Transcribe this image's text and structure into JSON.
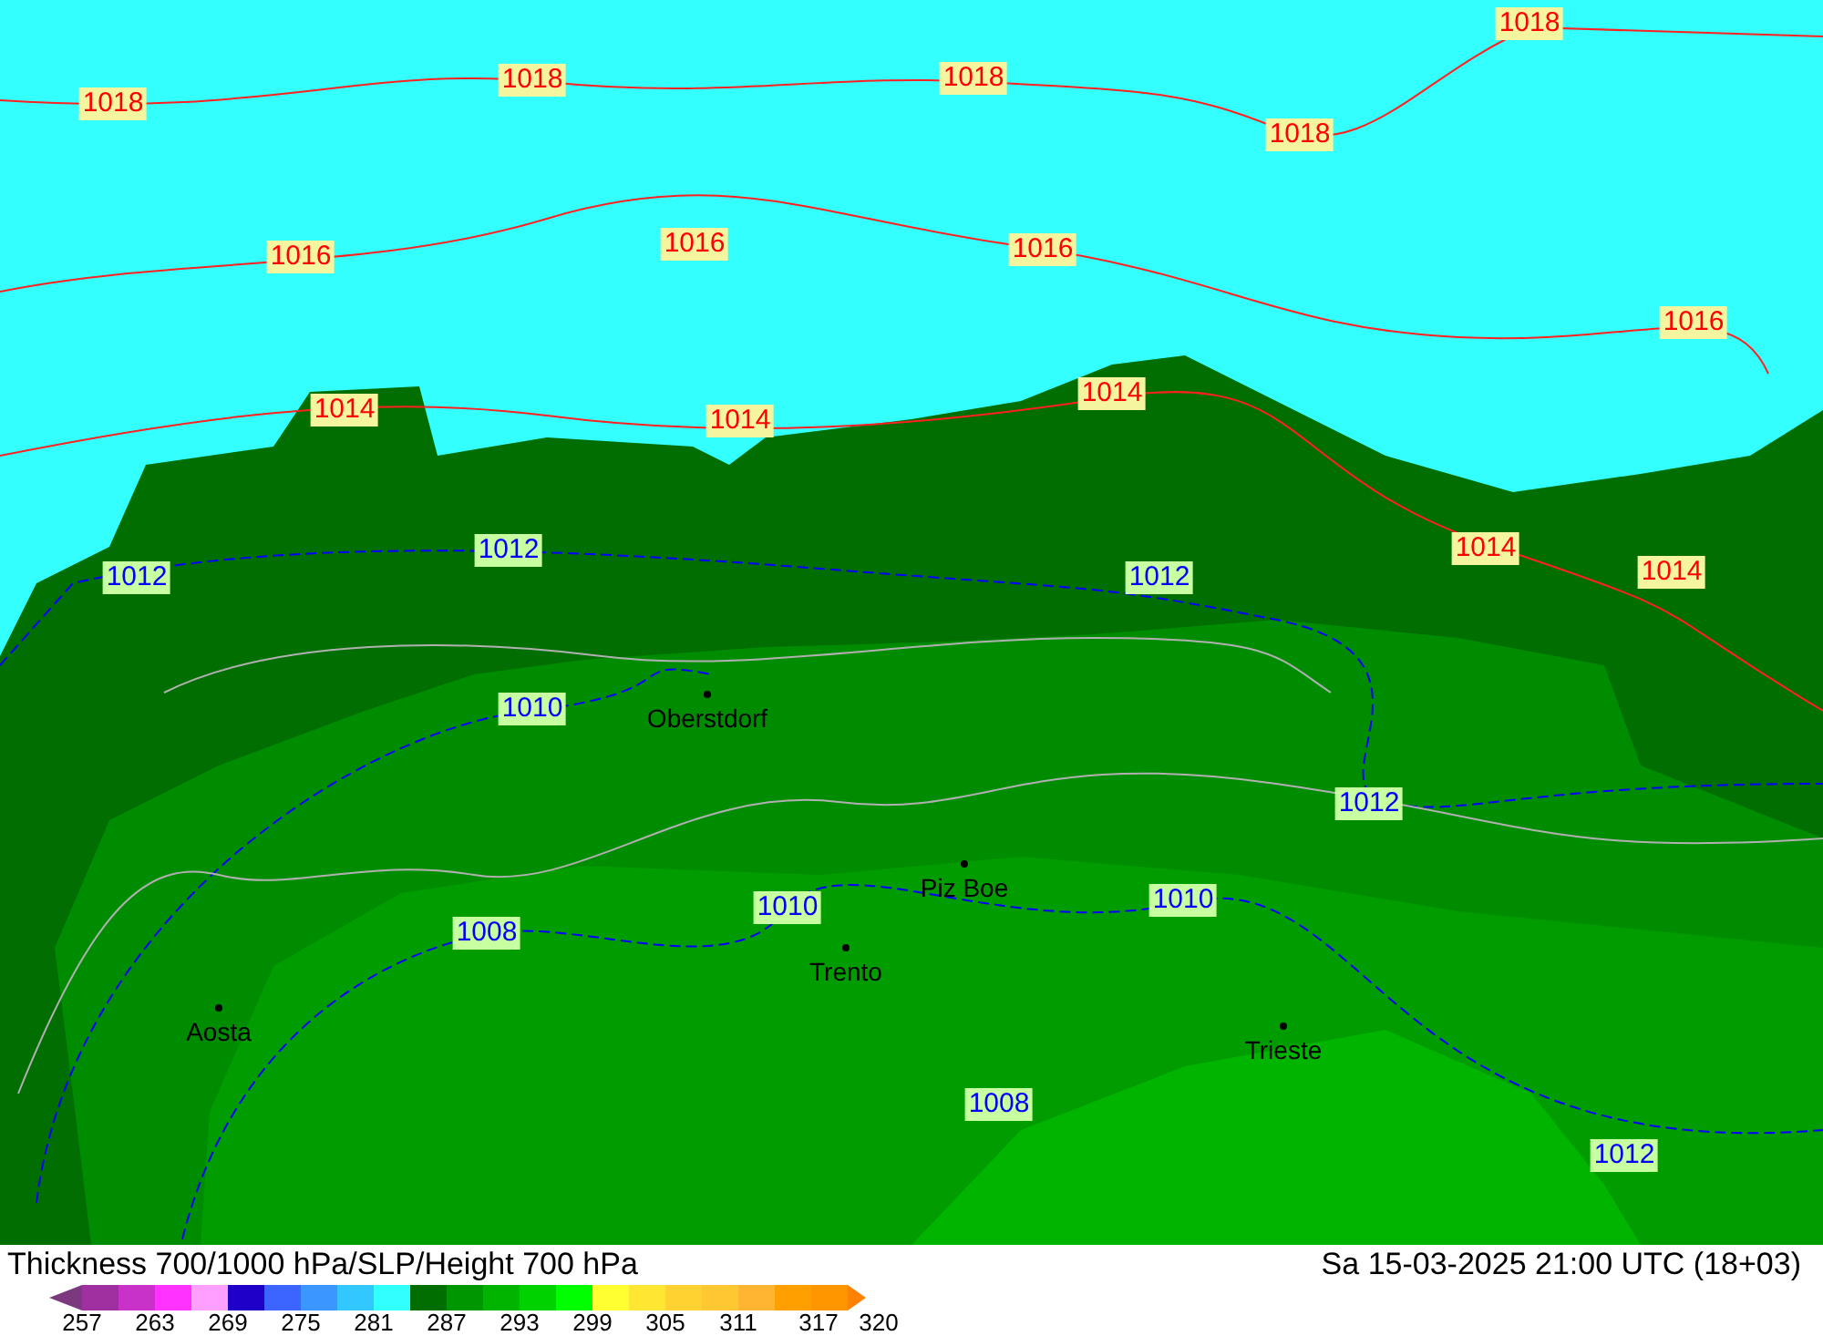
{
  "isobar_labels": [
    {
      "text": "1018",
      "kind": "red"
    },
    {
      "text": "1018",
      "kind": "red"
    },
    {
      "text": "1018",
      "kind": "red"
    },
    {
      "text": "1018",
      "kind": "red"
    },
    {
      "text": "1018",
      "kind": "red"
    },
    {
      "text": "1016",
      "kind": "red"
    },
    {
      "text": "1016",
      "kind": "red"
    },
    {
      "text": "1016",
      "kind": "red"
    },
    {
      "text": "1016",
      "kind": "red"
    },
    {
      "text": "1014",
      "kind": "red"
    },
    {
      "text": "1014",
      "kind": "red"
    },
    {
      "text": "1014",
      "kind": "red"
    },
    {
      "text": "1012",
      "kind": "blue"
    },
    {
      "text": "1012",
      "kind": "blue"
    },
    {
      "text": "1012",
      "kind": "blue"
    },
    {
      "text": "1014",
      "kind": "red"
    },
    {
      "text": "1014",
      "kind": "red"
    },
    {
      "text": "1010",
      "kind": "blue"
    },
    {
      "text": "1012",
      "kind": "blue"
    },
    {
      "text": "1008",
      "kind": "blue"
    },
    {
      "text": "1010",
      "kind": "blue"
    },
    {
      "text": "1010",
      "kind": "blue"
    },
    {
      "text": "1008",
      "kind": "blue"
    },
    {
      "text": "1012",
      "kind": "blue"
    }
  ],
  "cities": [
    {
      "name": "Oberstdorf"
    },
    {
      "name": "Piz Boe"
    },
    {
      "name": "Trento"
    },
    {
      "name": "Aosta"
    },
    {
      "name": "Trieste"
    }
  ],
  "title": "Thickness 700/1000 hPa/SLP/Height 700 hPa",
  "valid_time": "Sa 15-03-2025 21:00 UTC (18+03)",
  "legend": {
    "swatches": [
      {
        "kind": "low-arrow",
        "color": "#7b3a80"
      },
      {
        "color": "#a030a0"
      },
      {
        "color": "#c832c8"
      },
      {
        "color": "#ff32ff"
      },
      {
        "color": "#ffa0ff"
      },
      {
        "color": "#1e00c8"
      },
      {
        "color": "#3c64ff"
      },
      {
        "color": "#3c96ff"
      },
      {
        "color": "#32c8ff"
      },
      {
        "color": "#32ffff"
      },
      {
        "color": "#006e00"
      },
      {
        "color": "#009600"
      },
      {
        "color": "#00b400"
      },
      {
        "color": "#00d200"
      },
      {
        "color": "#00ff00"
      },
      {
        "color": "#ffff32"
      },
      {
        "color": "#ffe632"
      },
      {
        "color": "#ffd232"
      },
      {
        "color": "#ffc832"
      },
      {
        "color": "#ffb432"
      },
      {
        "color": "#ffa000"
      },
      {
        "color": "#ff9600"
      },
      {
        "kind": "high-arrow",
        "color": "#ff8200"
      }
    ],
    "ticks": [
      "257",
      "263",
      "269",
      "275",
      "281",
      "287",
      "293",
      "299",
      "305",
      "311",
      "317",
      "320"
    ]
  }
}
